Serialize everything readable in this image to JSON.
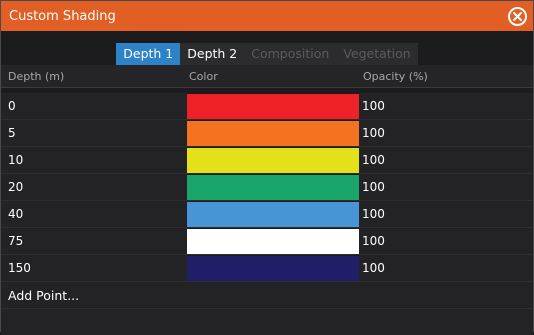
{
  "window": {
    "title": "Custom Shading",
    "close_icon": "close-circle-icon"
  },
  "tabs": [
    {
      "label": "Depth 1",
      "state": "active"
    },
    {
      "label": "Depth 2",
      "state": "normal"
    },
    {
      "label": "Composition",
      "state": "disabled"
    },
    {
      "label": "Vegetation",
      "state": "disabled"
    }
  ],
  "table": {
    "headers": {
      "depth": "Depth (m)",
      "color": "Color",
      "opacity": "Opacity (%)"
    },
    "rows": [
      {
        "depth": "0",
        "color": "#ee2128",
        "opacity": "100"
      },
      {
        "depth": "5",
        "color": "#f47321",
        "opacity": "100"
      },
      {
        "depth": "10",
        "color": "#e2e11a",
        "opacity": "100"
      },
      {
        "depth": "20",
        "color": "#1aa66a",
        "opacity": "100"
      },
      {
        "depth": "40",
        "color": "#4794d6",
        "opacity": "100"
      },
      {
        "depth": "75",
        "color": "#ffffff",
        "opacity": "100"
      },
      {
        "depth": "150",
        "color": "#1f1e66",
        "opacity": "100"
      }
    ],
    "add_point_label": "Add Point..."
  },
  "colors": {
    "titlebar": "#e15f24",
    "active_tab": "#2e83c8"
  }
}
